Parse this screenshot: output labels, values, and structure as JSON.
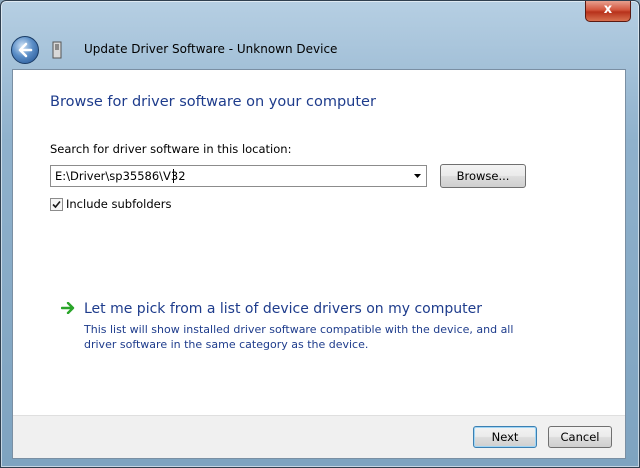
{
  "window": {
    "title": "Update Driver Software - Unknown Device",
    "close_glyph": "x"
  },
  "content": {
    "heading": "Browse for driver software on your computer",
    "search_label": "Search for driver software in this location:",
    "path_value": "E:\\Driver\\sp35586\\V32",
    "browse_label": "Browse...",
    "include_subfolders_label": "Include subfolders",
    "include_subfolders_checked": true,
    "pick_link": "Let me pick from a list of device drivers on my computer",
    "pick_description": "This list will show installed driver software compatible with the device, and all driver software in the same category as the device."
  },
  "footer": {
    "next_label": "Next",
    "cancel_label": "Cancel"
  },
  "colors": {
    "link_blue": "#1e3c8c",
    "arrow_green": "#2aa52a",
    "close_red": "#c8432a"
  },
  "icons": {
    "back": "back-arrow-icon",
    "device": "device-icon",
    "pick_arrow": "green-arrow-icon",
    "combo": "chevron-down-icon",
    "check": "checkmark-icon"
  }
}
